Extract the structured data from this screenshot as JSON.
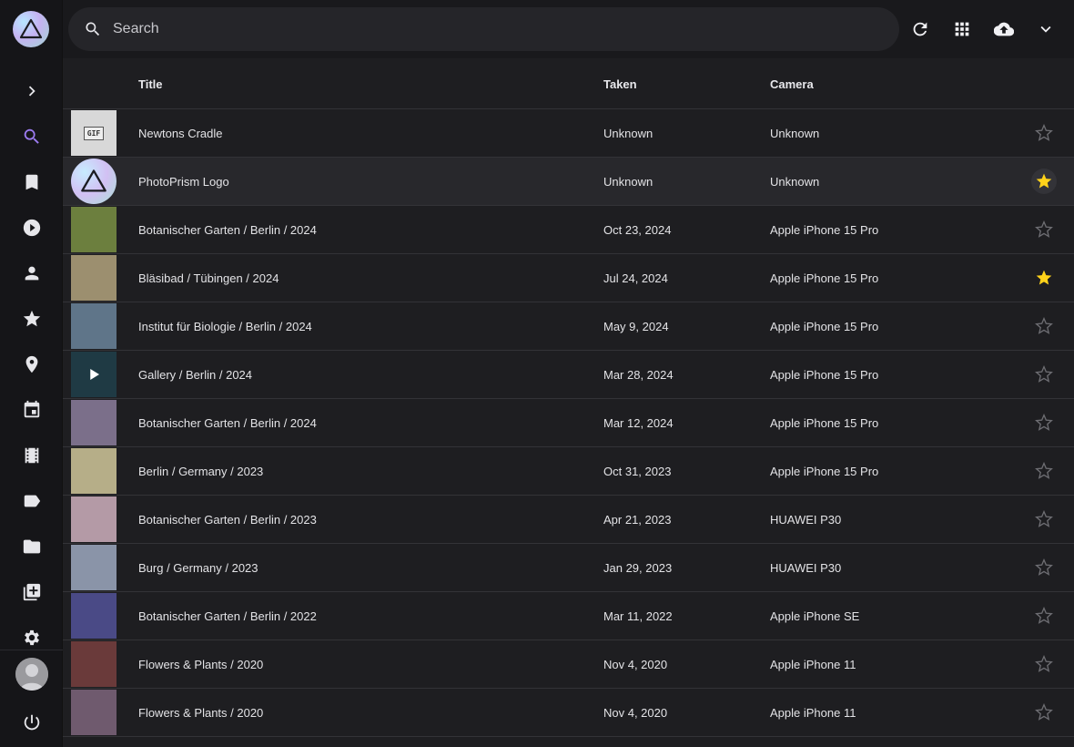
{
  "search": {
    "placeholder": "Search"
  },
  "table": {
    "headers": {
      "title": "Title",
      "taken": "Taken",
      "camera": "Camera"
    },
    "rows": [
      {
        "title": "Newtons Cradle",
        "taken": "Unknown",
        "camera": "Unknown",
        "favorite": false,
        "thumb_label": "GIF",
        "thumb_color": "#d8d8d8"
      },
      {
        "title": "PhotoPrism Logo",
        "taken": "Unknown",
        "camera": "Unknown",
        "favorite": true,
        "thumb_color": "#b9dfe6"
      },
      {
        "title": "Botanischer Garten / Berlin / 2024",
        "taken": "Oct 23, 2024",
        "camera": "Apple iPhone 15 Pro",
        "favorite": false,
        "thumb_color": "#6c7f3e"
      },
      {
        "title": "Bläsibad / Tübingen / 2024",
        "taken": "Jul 24, 2024",
        "camera": "Apple iPhone 15 Pro",
        "favorite": true,
        "thumb_color": "#9c8f6f"
      },
      {
        "title": "Institut für Biologie / Berlin / 2024",
        "taken": "May 9, 2024",
        "camera": "Apple iPhone 15 Pro",
        "favorite": false,
        "thumb_color": "#5f7589"
      },
      {
        "title": "Gallery / Berlin / 2024",
        "taken": "Mar 28, 2024",
        "camera": "Apple iPhone 15 Pro",
        "favorite": false,
        "thumb_color": "#1f3a44",
        "video": true
      },
      {
        "title": "Botanischer Garten / Berlin / 2024",
        "taken": "Mar 12, 2024",
        "camera": "Apple iPhone 15 Pro",
        "favorite": false,
        "thumb_color": "#7b6f8a"
      },
      {
        "title": "Berlin / Germany / 2023",
        "taken": "Oct 31, 2023",
        "camera": "Apple iPhone 15 Pro",
        "favorite": false,
        "thumb_color": "#b6ae88"
      },
      {
        "title": "Botanischer Garten / Berlin / 2023",
        "taken": "Apr 21, 2023",
        "camera": "HUAWEI P30",
        "favorite": false,
        "thumb_color": "#b49aa6"
      },
      {
        "title": "Burg / Germany / 2023",
        "taken": "Jan 29, 2023",
        "camera": "HUAWEI P30",
        "favorite": false,
        "thumb_color": "#8a94a8"
      },
      {
        "title": "Botanischer Garten / Berlin / 2022",
        "taken": "Mar 11, 2022",
        "camera": "Apple iPhone SE",
        "favorite": false,
        "thumb_color": "#4a4a86"
      },
      {
        "title": "Flowers & Plants / 2020",
        "taken": "Nov 4, 2020",
        "camera": "Apple iPhone 11",
        "favorite": false,
        "thumb_color": "#6a3a3a"
      },
      {
        "title": "Flowers & Plants / 2020",
        "taken": "Nov 4, 2020",
        "camera": "Apple iPhone 11",
        "favorite": false,
        "thumb_color": "#6f5a6e"
      }
    ]
  },
  "colors": {
    "accent": "#9c7bf0",
    "favorite": "#ffd21a"
  }
}
